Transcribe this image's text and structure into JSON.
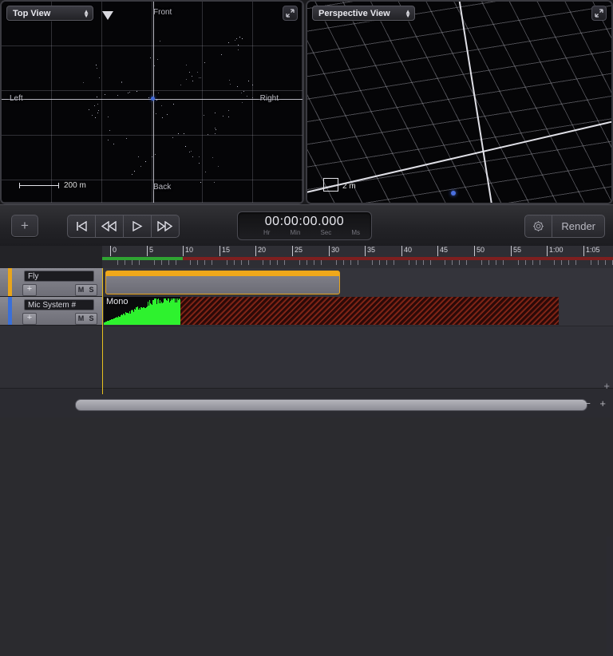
{
  "viewports": [
    {
      "id": "top-view",
      "title": "Top View",
      "labels": {
        "front": "Front",
        "back": "Back",
        "left": "Left",
        "right": "Right"
      },
      "scale": "200 m"
    },
    {
      "id": "perspective-view",
      "title": "Perspective View",
      "scale": "2 m"
    }
  ],
  "transport": {
    "add_label": "+",
    "buttons": [
      {
        "name": "go-to-start",
        "glyph": "skip-start"
      },
      {
        "name": "rewind",
        "glyph": "rewind"
      },
      {
        "name": "play",
        "glyph": "play"
      },
      {
        "name": "fast-forward",
        "glyph": "forward"
      }
    ],
    "timecode": {
      "value": "00:00:00.000",
      "units": [
        "Hr",
        "Min",
        "Sec",
        "Ms"
      ]
    },
    "settings_icon": "gear-icon",
    "render_label": "Render"
  },
  "ruler": {
    "ticks": [
      "0",
      "5",
      "10",
      "15",
      "20",
      "25",
      "30",
      "35",
      "40",
      "45",
      "50",
      "55",
      "1:00",
      "1:05"
    ],
    "cycle_green_end_label": "10",
    "playhead_position": "0"
  },
  "tracks": [
    {
      "name": "Fly",
      "add_label": "+",
      "mute_label": "M",
      "solo_label": "S",
      "selected_color": "#e8a51c",
      "clip": {
        "label": "",
        "type": "automation"
      }
    },
    {
      "name": "Mic System #",
      "add_label": "+",
      "mute_label": "M",
      "solo_label": "S",
      "selected_color": "#3a6fd8",
      "clip": {
        "label": "Mono",
        "type": "audio"
      }
    }
  ],
  "bottom": {
    "zoom_out_label": "−",
    "zoom_in_label": "+",
    "corner_add_label": "+"
  },
  "colors": {
    "accent_orange": "#e8a51c",
    "accent_blue": "#3a6fd8",
    "waveform_green": "#2ef22e",
    "cycle_green": "#2fa432",
    "cycle_red": "#7e1f1f",
    "hatch_red": "#8a2a18"
  }
}
